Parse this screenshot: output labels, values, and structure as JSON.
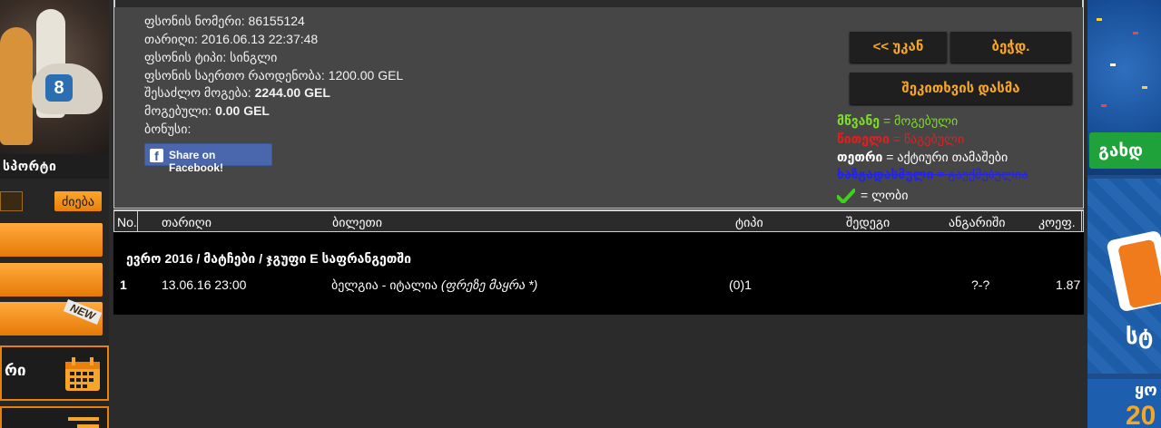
{
  "left": {
    "sports_label": "სპორტი",
    "search_button": "ძიება",
    "new_badge": "NEW",
    "calendar_label": "რი"
  },
  "ticket": {
    "number_line": "ფსონის ნომერი: 86155124",
    "date_line": "თარიღი: 2016.06.13 22:37:48",
    "type_line": "ფსონის ტიპი: სინგლი",
    "total_amount_line": "ფსონის საერთო რაოდენობა: 1200.00 GEL",
    "possible_win_label": "შესაძლო მოგება: ",
    "possible_win_value": "2244.00 GEL",
    "win_label": "მოგებული: ",
    "win_value": "0.00 GEL",
    "bonus_line": "ბონუსი:",
    "facebook_share": "Share on Facebook!"
  },
  "actions": {
    "back": "<< უკან",
    "print": "ბეჭდ.",
    "send_question": "შეკითხვის დასმა"
  },
  "legend": {
    "green_key": "მწვანე",
    "green_text": " = მოგებული",
    "red_key": "წითელი",
    "red_text": " = წაგებული",
    "white_key": "თეთრი",
    "white_text": " = აქტიური თამაშები",
    "blue_key": "ხაზგადასმული",
    "blue_text": " = გაუქმებულია",
    "check_text": "= ლობი"
  },
  "table": {
    "headers": [
      "No.",
      "თარიღი",
      "ბილეთი",
      "ტიპი",
      "შედეგი",
      "ანგარიში",
      "კოეფ."
    ],
    "group_title": "ევრო 2016 / მატჩები / ჯგუფი E საფრანგეთში",
    "rows": [
      {
        "no": "1",
        "date": "13.06.16 23:00",
        "match": "ბელგია - იტალია",
        "pick": "(ფრეზე მაყრა *)",
        "type": "(0)1",
        "result": "",
        "score": "?-?",
        "odds": "1.87"
      }
    ]
  },
  "right": {
    "green_button": "გახდ",
    "mid_text": "სტ",
    "bottom_text": "ყო",
    "bottom_num": "20"
  },
  "colors": {
    "accent_orange": "#f4a52a",
    "win_green": "#7ddb2a",
    "loss_red": "#e0201e",
    "cancel_blue": "#2424e6",
    "facebook_blue": "#4a67ad"
  }
}
